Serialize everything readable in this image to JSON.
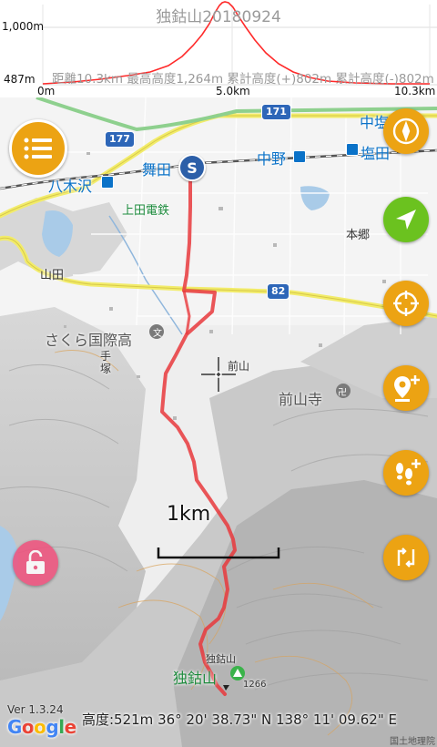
{
  "profile": {
    "title": "独鈷山20180924",
    "y_max_label": "1,000m",
    "y_min_label": "487m",
    "stats": "距離10.3km 最高高度1,264m 累計高度(+)802m 累計高度(-)802m",
    "x_start": "0m",
    "x_mid": "5.0km",
    "x_end": "10.3km",
    "line_color": "#ff2a2a"
  },
  "map": {
    "start_marker": "S",
    "labels": {
      "maita": "舞田",
      "nakano": "中野",
      "shiodajou": "塩田",
      "nakashio": "中塩",
      "yagisawa": "八木沢",
      "ueda_dentetsu": "上田電鉄",
      "hongo": "本郷",
      "yamada": "山田",
      "sakura_kokusai": "さくら国際高",
      "tezuka": "手塚",
      "maeyama": "前山",
      "zensanji": "前山寺",
      "tokkosan": "独鈷山",
      "tokkosan_small": "独鈷山",
      "summit_elev": "1266"
    },
    "roads": [
      "177",
      "171",
      "82"
    ],
    "scale_label": "1km",
    "track_color": "#e8383c"
  },
  "buttons": {
    "menu": "menu-icon",
    "compass": "compass-icon",
    "locate": "navigation-arrow-icon",
    "crosshair": "crosshair-icon",
    "add_waypoint": "add-pin-icon",
    "add_track": "add-footsteps-icon",
    "route": "route-icon",
    "lock": "unlock-icon"
  },
  "status": {
    "version": "Ver 1.3.24",
    "google": "Google",
    "coords": "高度:521m  36°  20' 38.73\" N 138°  11' 09.62\" E",
    "attribution": "国土地理院"
  }
}
